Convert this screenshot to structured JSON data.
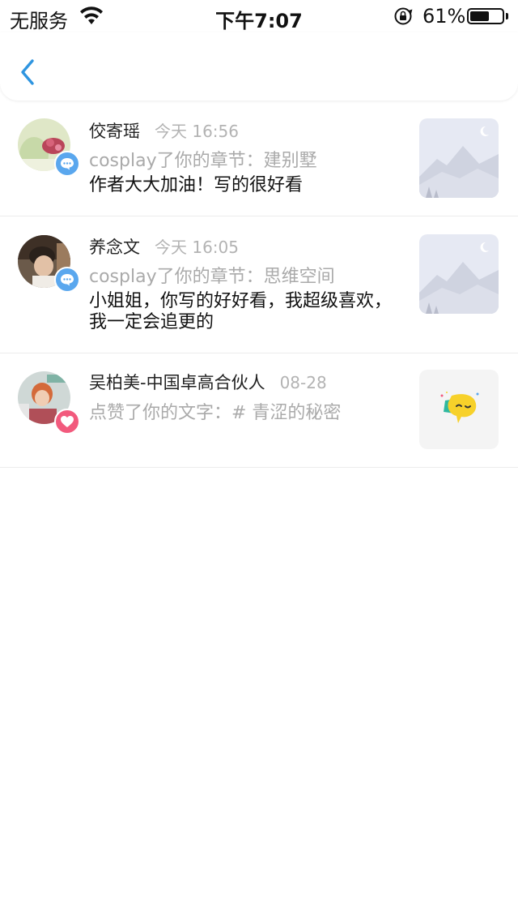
{
  "status_bar": {
    "carrier": "无服务",
    "time": "下午7:07",
    "battery_percent": "61%",
    "battery_level": 0.61
  },
  "nav": {
    "back_icon": "chevron-left-icon"
  },
  "notifications": [
    {
      "name": "佼寄瑶",
      "time": "今天 16:56",
      "action": "cosplay了你的章节：建别墅",
      "content": "作者大大加油！写的很好看",
      "badge": "comment",
      "thumb": "mountain-placeholder"
    },
    {
      "name": "养念文",
      "time": "今天 16:05",
      "action": "cosplay了你的章节：思维空间",
      "content": "小姐姐，你写的好好看，我超级喜欢，我一定会追更的",
      "badge": "comment",
      "thumb": "mountain-placeholder"
    },
    {
      "name": "吴柏美-中国卓高合伙人",
      "time": "08-28",
      "action": "点赞了你的文字：# 青涩的秘密",
      "content": "",
      "badge": "like",
      "thumb": "chat-bubble-sticker"
    }
  ],
  "colors": {
    "accent": "#2f95e0",
    "comment_badge": "#5aa7ee",
    "like_badge": "#f25a7d",
    "muted_text": "#aaaaaa"
  }
}
